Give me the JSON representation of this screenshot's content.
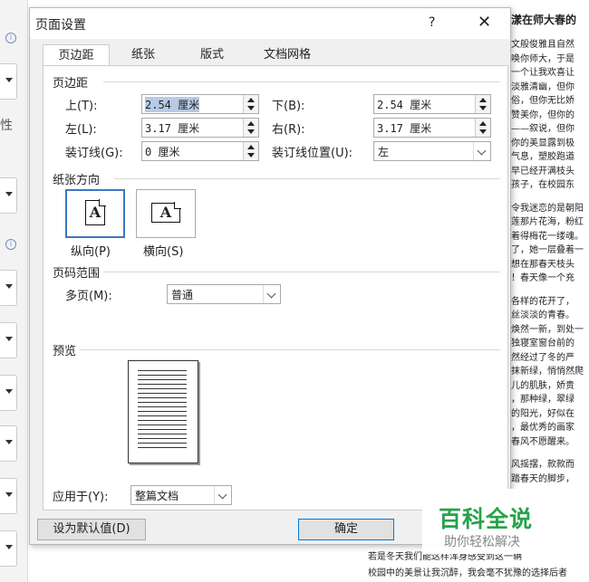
{
  "left_sidebar": {
    "partial_label": "性"
  },
  "background_doc": {
    "title": "漾在师大春的",
    "lines": [
      "文般俊雅且自然",
      "唤你师大，于是",
      "一个让我欢喜让",
      "淡雅清幽，但你",
      "俗，但你无比娇",
      "赞美你，但你的",
      "——叙说，但你",
      "你的美显露到极",
      "气息，塑胶跑道",
      "早已经开满枝头",
      "孩子，在校园东",
      "",
      "令我迷恋的是朝阳",
      "莲那片花海，粉红",
      "着得梅花一缕魂。",
      "了，她一层叠着一",
      "想在那春天枝头",
      "！春天像一个充",
      "",
      "各样的花开了，",
      "丝淡淡的青春。",
      "焕然一新，到处一",
      "独寝室窗台前的",
      "然经过了冬的严",
      "抹新绿，悄悄然爬",
      "儿的肌肤，娇贵",
      "，那种绿，翠绿",
      "的阳光，好似在",
      "，最优秀的画家",
      "春风不愿醒来。",
      "",
      "风摇摆，款款而",
      "踏春天的脚步，"
    ]
  },
  "bottom_doc": {
    "lines": [
      "若是冬天我们能这样浑身感受到这一辆",
      "校园中的美景让我沉醉，我会毫不犹豫的选择后者"
    ]
  },
  "dialog": {
    "title": "页面设置",
    "help": "?",
    "close": "✕",
    "tabs": [
      "页边距",
      "纸张",
      "版式",
      "文档网格"
    ],
    "margins": {
      "section": "页边距",
      "top_label": "上(T):",
      "top_value": "2.54 厘米",
      "bottom_label": "下(B):",
      "bottom_value": "2.54 厘米",
      "left_label": "左(L):",
      "left_value": "3.17 厘米",
      "right_label": "右(R):",
      "right_value": "3.17 厘米",
      "gutter_label": "装订线(G):",
      "gutter_value": "0 厘米",
      "gutter_pos_label": "装订线位置(U):",
      "gutter_pos_value": "左"
    },
    "orientation": {
      "section": "纸张方向",
      "portrait": "纵向(P)",
      "landscape": "横向(S)",
      "glyph": "A",
      "selected": "portrait"
    },
    "pages": {
      "section": "页码范围",
      "multi_label": "多页(M):",
      "multi_value": "普通"
    },
    "preview": {
      "section": "预览"
    },
    "apply": {
      "label": "应用于(Y):",
      "value": "整篇文档"
    },
    "buttons": {
      "default": "设为默认值(D)",
      "ok": "确定"
    }
  },
  "watermark": {
    "main": "百科全说",
    "sub": "助你轻松解决"
  },
  "colors": {
    "selection": "#b7cbe6",
    "accent": "#3a78c2",
    "watermark": "#27a24a"
  }
}
